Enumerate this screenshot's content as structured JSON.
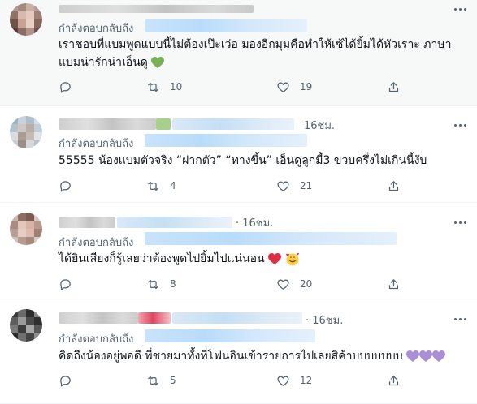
{
  "tweets": [
    {
      "reply_prefix": "กำลังตอบกลับถึง",
      "text": "เราชอบที่แบมพูดแบบนี้ไม่ต้องเป๊ะเว่อ มองอีกมุมคือทำให้เซ้ได้ยิ้มได้หัวเราะ ภาษาแบมน่ารักน่าเอ็นดู",
      "text_emoji": "green-heart",
      "time": "",
      "replies": "",
      "retweets": "10",
      "likes": "19"
    },
    {
      "reply_prefix": "กำลังตอบกลับถึง",
      "text": "55555 น้องแบมตัวจริง “ฝากตัว”  “ทางขึ้น” เอ็นดูลูกมี้3 ขวบครึ่งไม่เกินนี้งับ",
      "time": "16ชม.",
      "replies": "",
      "retweets": "4",
      "likes": "21"
    },
    {
      "reply_prefix": "กำลังตอบกลับถึง",
      "text": "ได้ยินเสียงก็รู้เลยว่าต้องพูดไปยิ้มไปแน่นอน",
      "text_emoji": "red-heart, smiling-face-with-hearts",
      "time": "· 16ชม.",
      "replies": "",
      "retweets": "8",
      "likes": "20"
    },
    {
      "reply_prefix": "กำลังตอบกลับถึง",
      "text": "คิดถึงน้องอยู่พอดี พี่ชายมาทั้งที่โฟนอินเข้ารายการไปเลยสิค้าบบบบบบบ",
      "text_emoji": "purple-heart x3",
      "time": "· 16ชม.",
      "replies": "",
      "retweets": "5",
      "likes": "12"
    }
  ],
  "colors": {
    "text": "#0f1419",
    "muted": "#536471",
    "highlight_bg": "#f7f9f9",
    "divider": "#eff3f4"
  }
}
